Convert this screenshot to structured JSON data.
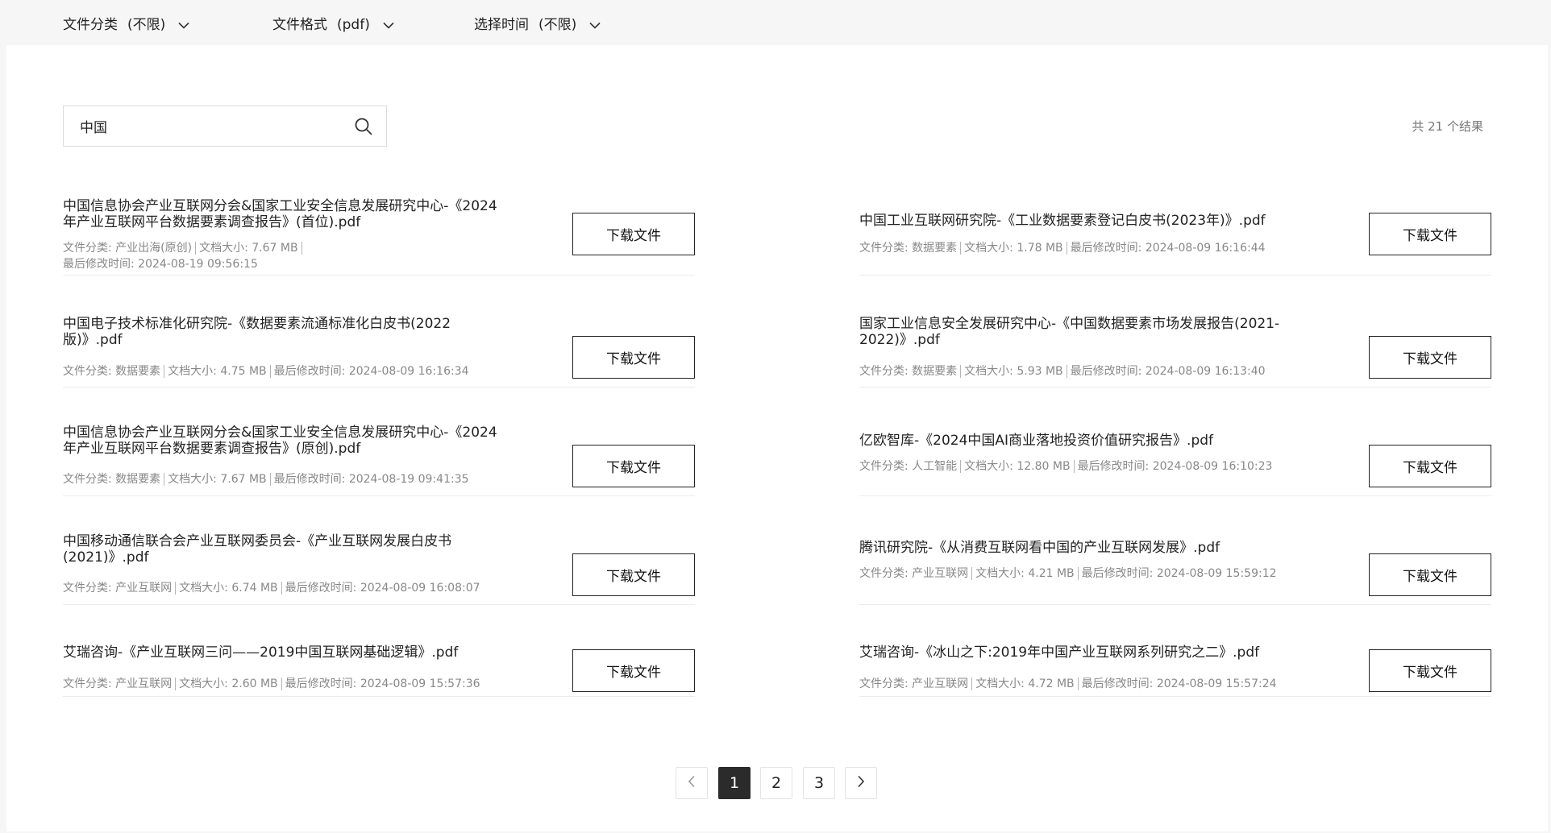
{
  "filters": [
    {
      "label": "文件分类",
      "value": "(不限)"
    },
    {
      "label": "文件格式",
      "value": "(pdf)"
    },
    {
      "label": "选择时间",
      "value": "(不限)"
    }
  ],
  "search": {
    "value": "中国",
    "placeholder": ""
  },
  "result_count": "共 21 个结果",
  "download_label": "下载文件",
  "results_left": [
    {
      "title": "中国信息协会产业互联网分会&国家工业安全信息发展研究中心-《2024年产业互联网平台数据要素调查报告》(首位).pdf",
      "category": "文件分类: 产业出海(原创)",
      "size": "文档大小: 7.67 MB",
      "modified": "最后修改时间: 2024-08-19 09:56:15"
    },
    {
      "title": "中国电子技术标准化研究院-《数据要素流通标准化白皮书(2022版)》.pdf",
      "category": "文件分类: 数据要素",
      "size": "文档大小: 4.75 MB",
      "modified": "最后修改时间: 2024-08-09 16:16:34"
    },
    {
      "title": "中国信息协会产业互联网分会&国家工业安全信息发展研究中心-《2024年产业互联网平台数据要素调查报告》(原创).pdf",
      "category": "文件分类: 数据要素",
      "size": "文档大小: 7.67 MB",
      "modified": "最后修改时间: 2024-08-19 09:41:35"
    },
    {
      "title": "中国移动通信联合会产业互联网委员会-《产业互联网发展白皮书(2021)》.pdf",
      "category": "文件分类: 产业互联网",
      "size": "文档大小: 6.74 MB",
      "modified": "最后修改时间: 2024-08-09 16:08:07"
    },
    {
      "title": "艾瑞咨询-《产业互联网三问——2019中国互联网基础逻辑》.pdf",
      "category": "文件分类: 产业互联网",
      "size": "文档大小: 2.60 MB",
      "modified": "最后修改时间: 2024-08-09 15:57:36"
    }
  ],
  "results_right": [
    {
      "title": "中国工业互联网研究院-《工业数据要素登记白皮书(2023年)》.pdf",
      "category": "文件分类: 数据要素",
      "size": "文档大小: 1.78 MB",
      "modified": "最后修改时间: 2024-08-09 16:16:44"
    },
    {
      "title": "国家工业信息安全发展研究中心-《中国数据要素市场发展报告(2021-2022)》.pdf",
      "category": "文件分类: 数据要素",
      "size": "文档大小: 5.93 MB",
      "modified": "最后修改时间: 2024-08-09 16:13:40"
    },
    {
      "title": "亿欧智库-《2024中国AI商业落地投资价值研究报告》.pdf",
      "category": "文件分类: 人工智能",
      "size": "文档大小: 12.80 MB",
      "modified": "最后修改时间: 2024-08-09 16:10:23"
    },
    {
      "title": "腾讯研究院-《从消费互联网看中国的产业互联网发展》.pdf",
      "category": "文件分类: 产业互联网",
      "size": "文档大小: 4.21 MB",
      "modified": "最后修改时间: 2024-08-09 15:59:12"
    },
    {
      "title": "艾瑞咨询-《冰山之下:2019年中国产业互联网系列研究之二》.pdf",
      "category": "文件分类: 产业互联网",
      "size": "文档大小: 4.72 MB",
      "modified": "最后修改时间: 2024-08-09 15:57:24"
    }
  ],
  "pagination": {
    "pages": [
      "1",
      "2",
      "3"
    ],
    "current": "1"
  }
}
